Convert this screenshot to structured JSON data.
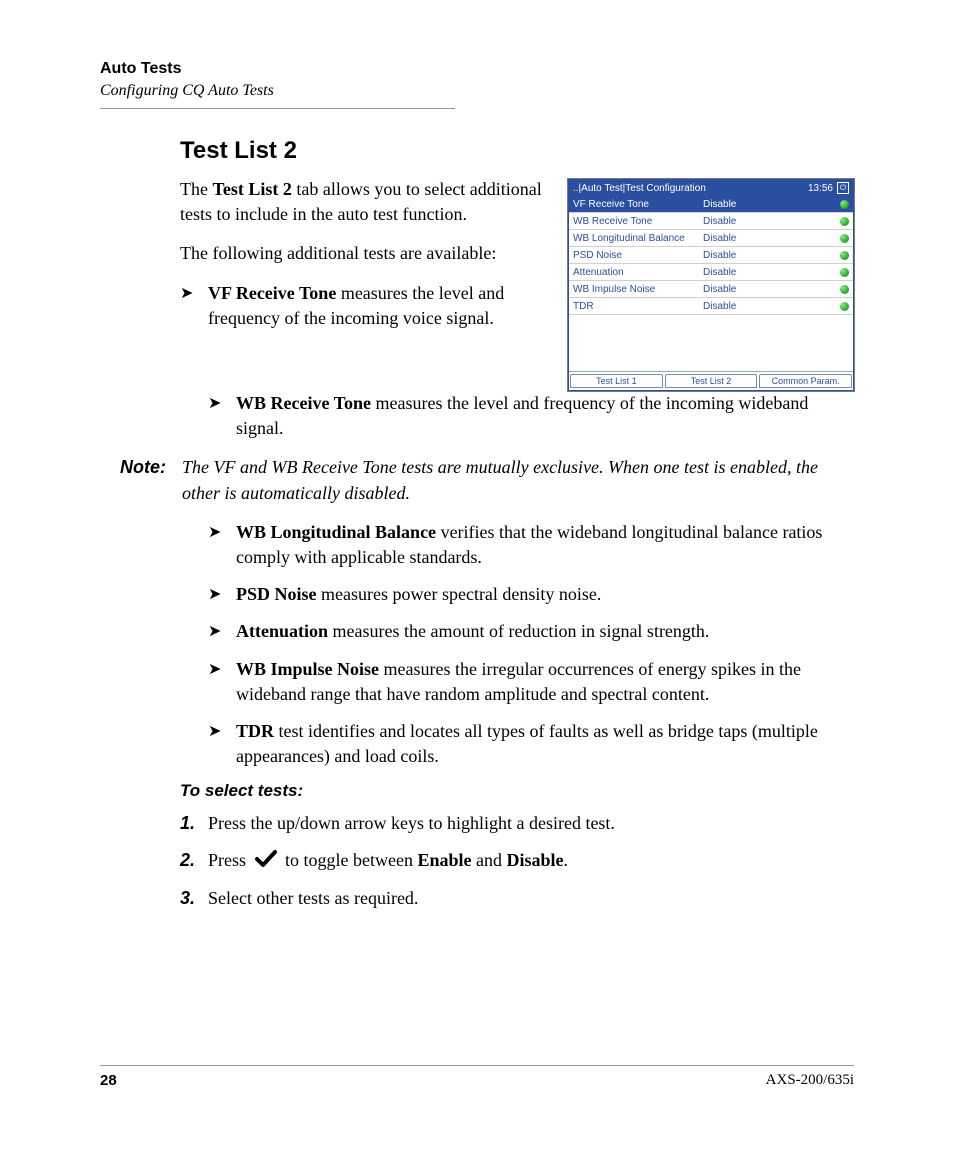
{
  "header": {
    "title": "Auto Tests",
    "subtitle": "Configuring CQ Auto Tests"
  },
  "section": {
    "title": "Test List 2",
    "intro_p1_a": "The ",
    "intro_p1_b": "Test List 2",
    "intro_p1_c": " tab allows you to select additional tests to include in the auto test function.",
    "intro_p2": "The following additional tests are available:"
  },
  "figure": {
    "breadcrumb": "..|Auto Test|Test Configuration",
    "clock": "13:56",
    "rows": [
      {
        "name": "VF Receive Tone",
        "value": "Disable",
        "selected": true
      },
      {
        "name": "WB Receive Tone",
        "value": "Disable",
        "selected": false
      },
      {
        "name": "WB Longitudinal Balance",
        "value": "Disable",
        "selected": false
      },
      {
        "name": "PSD Noise",
        "value": "Disable",
        "selected": false
      },
      {
        "name": "Attenuation",
        "value": "Disable",
        "selected": false
      },
      {
        "name": "WB Impulse Noise",
        "value": "Disable",
        "selected": false
      },
      {
        "name": "TDR",
        "value": "Disable",
        "selected": false
      }
    ],
    "tabs": [
      "Test List 1",
      "Test List 2",
      "Common Param."
    ]
  },
  "bullets_top": [
    {
      "term": "VF Receive Tone",
      "rest": " measures the level and frequency of the incoming voice signal."
    }
  ],
  "bullets_mid": [
    {
      "term": "WB Receive Tone",
      "rest": " measures the level and frequency of the incoming wideband signal."
    }
  ],
  "note": {
    "label": "Note:",
    "text": "The VF and WB Receive Tone tests are mutually exclusive. When one test is enabled, the other is automatically disabled."
  },
  "bullets_bottom": [
    {
      "term": "WB Longitudinal Balance",
      "rest": " verifies that the wideband longitudinal balance ratios comply with applicable standards."
    },
    {
      "term": "PSD Noise",
      "rest": " measures power spectral density noise."
    },
    {
      "term": "Attenuation",
      "rest": " measures the amount of reduction in signal strength."
    },
    {
      "term": "WB Impulse Noise",
      "rest": " measures the irregular occurrences of energy spikes in the wideband range that have random amplitude and spectral content."
    },
    {
      "term": "TDR",
      "rest": " test identifies and locates all types of faults as well as bridge taps (multiple appearances) and load coils."
    }
  ],
  "procedure": {
    "heading": "To select tests:",
    "steps": [
      {
        "n": "1.",
        "text": "Press the up/down arrow keys to highlight a desired test."
      },
      {
        "n": "2.",
        "pre": "Press ",
        "mid": " to toggle between ",
        "b1": "Enable",
        "and": " and ",
        "b2": "Disable",
        "post": "."
      },
      {
        "n": "3.",
        "text": "Select other tests as required."
      }
    ]
  },
  "footer": {
    "page": "28",
    "doc": "AXS-200/635i"
  }
}
